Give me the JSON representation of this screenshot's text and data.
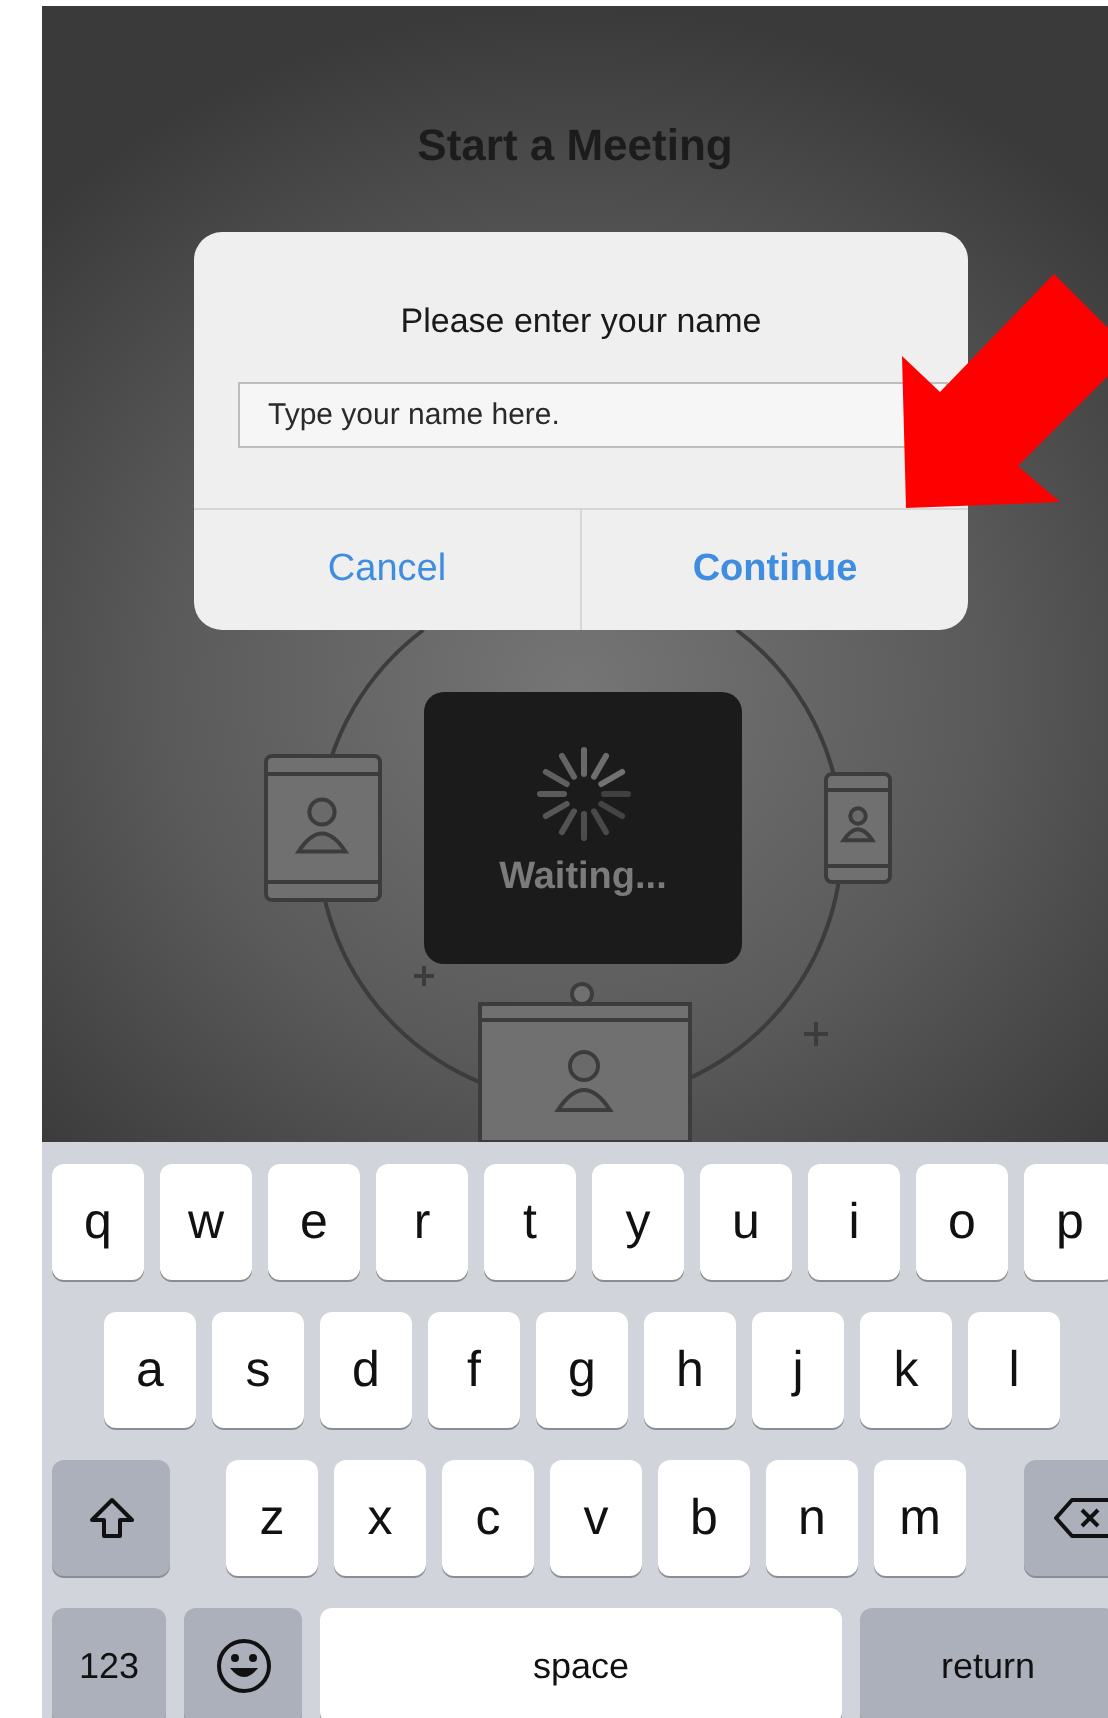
{
  "screen_title": "Start a Meeting",
  "waiting_card": {
    "label": "Waiting..."
  },
  "dialog": {
    "title": "Please enter your name",
    "name_field": {
      "placeholder": "Type your name here."
    },
    "buttons": [
      {
        "label": "Cancel",
        "kind": "cancel"
      },
      {
        "label": "Continue",
        "kind": "default"
      }
    ]
  },
  "keyboard": {
    "top_row": {
      "keys": [
        {
          "kind": "letter",
          "label": "q"
        },
        {
          "kind": "letter",
          "label": "w"
        },
        {
          "kind": "letter",
          "label": "e"
        },
        {
          "kind": "letter",
          "label": "r"
        },
        {
          "kind": "letter",
          "label": "t"
        },
        {
          "kind": "letter",
          "label": "y"
        },
        {
          "kind": "letter",
          "label": "u"
        },
        {
          "kind": "letter",
          "label": "i"
        },
        {
          "kind": "letter",
          "label": "o"
        },
        {
          "kind": "letter",
          "label": "p"
        }
      ]
    },
    "home_row": {
      "keys": [
        {
          "kind": "letter",
          "label": "a"
        },
        {
          "kind": "letter",
          "label": "s"
        },
        {
          "kind": "letter",
          "label": "d"
        },
        {
          "kind": "letter",
          "label": "f"
        },
        {
          "kind": "letter",
          "label": "g"
        },
        {
          "kind": "letter",
          "label": "h"
        },
        {
          "kind": "letter",
          "label": "j"
        },
        {
          "kind": "letter",
          "label": "k"
        },
        {
          "kind": "letter",
          "label": "l"
        }
      ]
    },
    "bottom_letter_row": {
      "keys": [
        {
          "kind": "shift"
        },
        {
          "kind": "letter",
          "label": "z"
        },
        {
          "kind": "letter",
          "label": "x"
        },
        {
          "kind": "letter",
          "label": "c"
        },
        {
          "kind": "letter",
          "label": "v"
        },
        {
          "kind": "letter",
          "label": "b"
        },
        {
          "kind": "letter",
          "label": "n"
        },
        {
          "kind": "letter",
          "label": "m"
        },
        {
          "kind": "delete"
        }
      ]
    },
    "function_row": {
      "keys": [
        {
          "kind": "numbers",
          "label": "123"
        },
        {
          "kind": "emoji"
        },
        {
          "kind": "space",
          "label": "space"
        },
        {
          "kind": "return",
          "label": "return"
        }
      ]
    }
  }
}
